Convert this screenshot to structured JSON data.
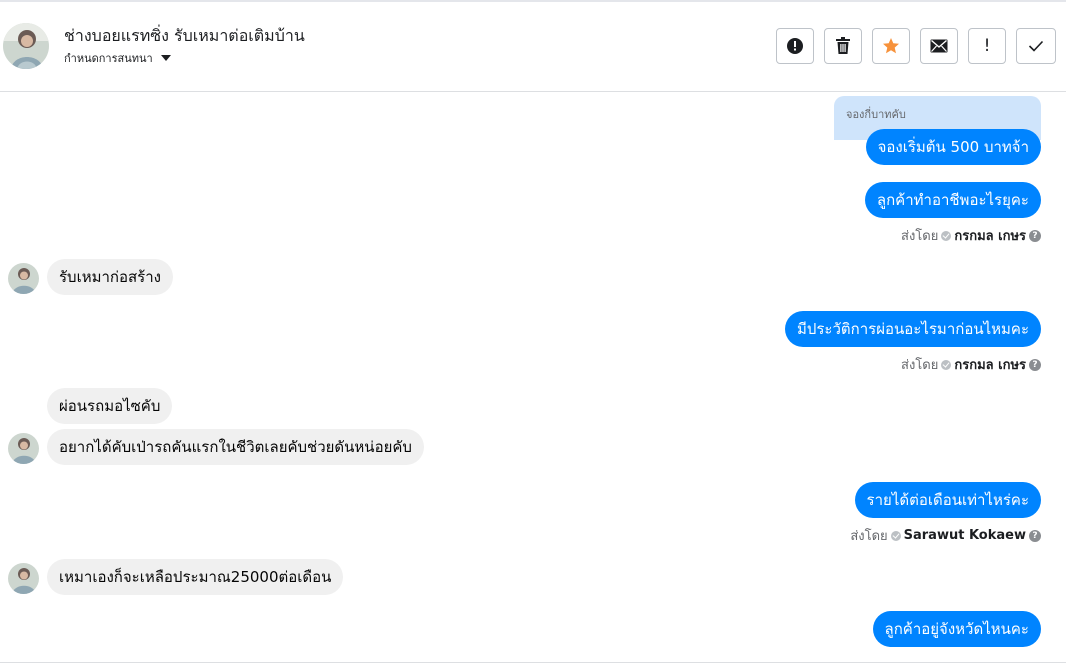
{
  "header": {
    "name": "ช่างบอยแรทซิ่ง รับเหมาต่อเติมบ้าน",
    "subtitle": "กำหนดการสนทนา",
    "toolbar": [
      {
        "name": "spam-button",
        "icon": "alert-circle-icon"
      },
      {
        "name": "delete-button",
        "icon": "trash-icon"
      },
      {
        "name": "star-button",
        "icon": "star-icon",
        "color": "#f7923b"
      },
      {
        "name": "email-button",
        "icon": "envelope-icon"
      },
      {
        "name": "follow-up-button",
        "icon": "exclamation-icon",
        "text": "!"
      },
      {
        "name": "done-button",
        "icon": "checkmark-icon"
      }
    ]
  },
  "conversation": {
    "reply_preview": "จองกี่บาทคับ",
    "messages": [
      {
        "dir": "out",
        "text": "จองเริ่มต้น 500 บาทจ้า"
      },
      {
        "dir": "out",
        "text": "ลูกค้าทำอาชีพอะไรยุคะ"
      },
      {
        "dir": "in",
        "text": "รับเหมาก่อสร้าง"
      },
      {
        "dir": "out",
        "text": "มีประวัติการผ่อนอะไรมาก่อนไหมคะ"
      },
      {
        "dir": "in",
        "text": "ผ่อนรถมอไซคับ"
      },
      {
        "dir": "in",
        "text": "อยากได้คับเป่ารถคันแรกในชีวิตเลยคับช่วยดันหน่อยคับ"
      },
      {
        "dir": "out",
        "text": "รายได้ต่อเดือนเท่าไหร่คะ"
      },
      {
        "dir": "in",
        "text": "เหมาเองก็จะเหลือประมาณ25000ต่อเดือน"
      },
      {
        "dir": "out",
        "text": "ลูกค้าอยู่จังหวัดไหนคะ"
      }
    ],
    "senders": [
      {
        "prefix": "ส่งโดย",
        "name": "กรกมล เกษร"
      },
      {
        "prefix": "ส่งโดย",
        "name": "กรกมล เกษร"
      },
      {
        "prefix": "ส่งโดย",
        "name": "Sarawut Kokaew"
      }
    ]
  },
  "colors": {
    "outgoing": "#0084ff",
    "incoming": "#f0f0f0",
    "star": "#f7923b"
  }
}
